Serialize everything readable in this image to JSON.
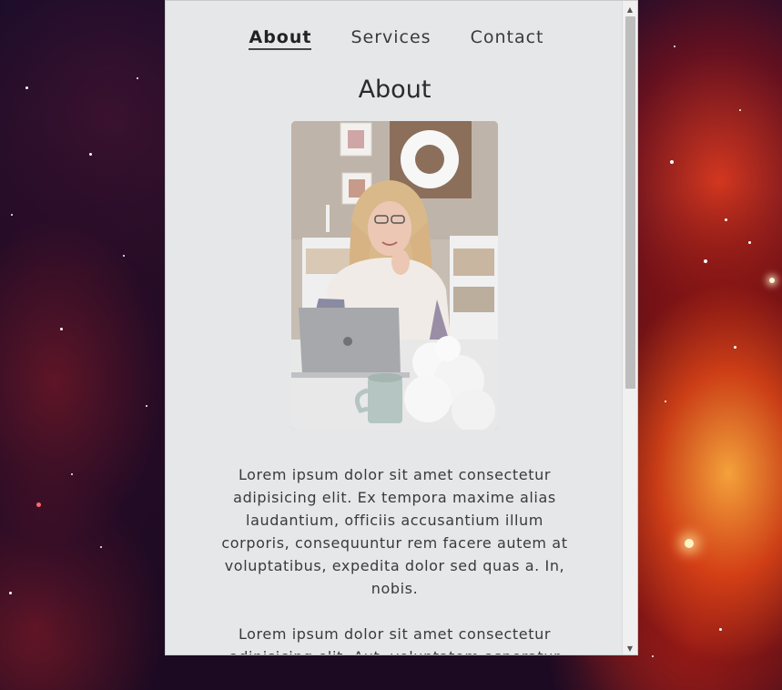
{
  "nav": {
    "items": [
      {
        "label": "About",
        "active": true
      },
      {
        "label": "Services",
        "active": false
      },
      {
        "label": "Contact",
        "active": false
      }
    ]
  },
  "main": {
    "heading": "About",
    "photo_icon": "portrait-photo",
    "paragraphs": [
      "Lorem ipsum dolor sit amet consectetur adipisicing elit. Ex tempora maxime alias laudantium, officiis accusantium illum corporis, consequuntur rem facere autem at voluptatibus, expedita dolor sed quas a. In, nobis.",
      "Lorem ipsum dolor sit amet consectetur adipisicing elit. Aut, voluptatem asperatur"
    ]
  },
  "scrollbar": {
    "up_icon": "arrow-up-icon",
    "down_icon": "arrow-down-icon"
  },
  "colors": {
    "panel_background": "#e6e7e9",
    "text": "#3a3a3a",
    "nebula_orange": "#e84a1e",
    "space_background": "#1a0c2a"
  }
}
